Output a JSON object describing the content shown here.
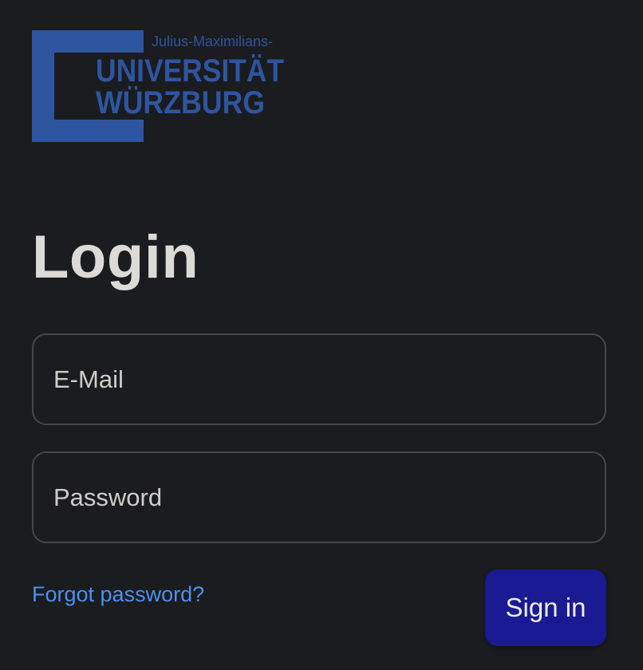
{
  "logo": {
    "line1": "Julius-Maximilians-",
    "line2": "UNIVERSITÄT",
    "line3": "WÜRZBURG",
    "color": "#2e55a0"
  },
  "login": {
    "title": "Login",
    "email_placeholder": "E-Mail",
    "password_placeholder": "Password",
    "forgot_link": "Forgot password?",
    "signin_label": "Sign in"
  },
  "colors": {
    "background": "#1b1c1f",
    "text": "#dcdad7",
    "link": "#4d8ff0",
    "button": "#1a1a92",
    "border": "#45474b"
  }
}
